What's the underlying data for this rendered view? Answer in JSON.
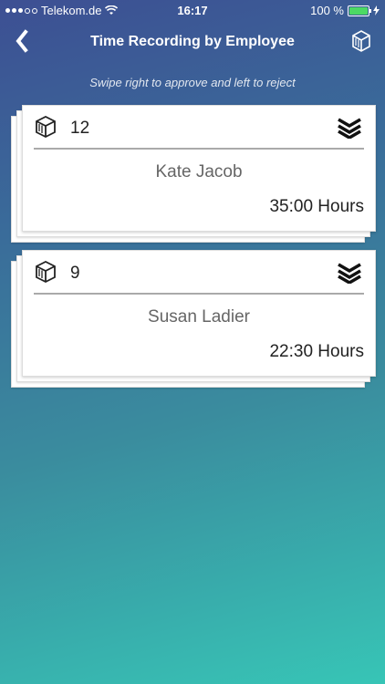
{
  "statusbar": {
    "carrier": "Telekom.de",
    "time": "16:17",
    "battery": "100 %"
  },
  "nav": {
    "title": "Time Recording by Employee"
  },
  "hint": "Swipe right to approve and left to reject",
  "cards": [
    {
      "number": "12",
      "name": "Kate Jacob",
      "hours": "35:00 Hours"
    },
    {
      "number": "9",
      "name": "Susan Ladier",
      "hours": "22:30 Hours"
    }
  ],
  "icons": {
    "back": "chevron-left-icon",
    "box": "box-icon",
    "layers": "layers-icon"
  }
}
